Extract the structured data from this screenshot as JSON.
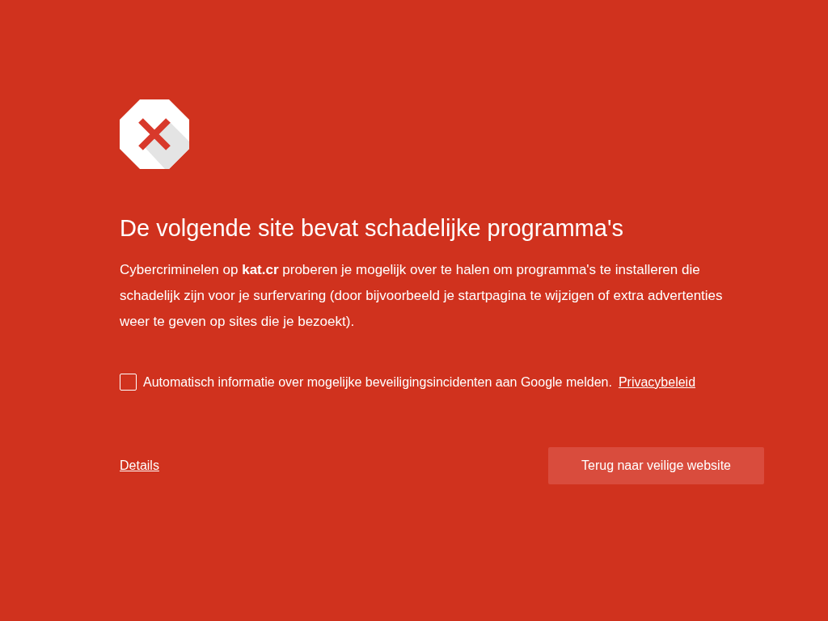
{
  "heading": "De volgende site bevat schadelijke programma's",
  "explanation": "Cybercriminelen op **kat.cr** proberen je mogelijk over te halen om programma's te installeren die schadelijk zijn voor je surfervaring (door bijvoorbeeld je startpagina te wijzigen of extra advertenties weer te geven op sites die je bezoekt).",
  "report": {
    "checked": false,
    "label": "Automatisch informatie over mogelijke beveiligingsincidenten aan Google melden.",
    "link": "Privacybeleid"
  },
  "details_link": "Details",
  "back_button": "Terug naar veilige website"
}
